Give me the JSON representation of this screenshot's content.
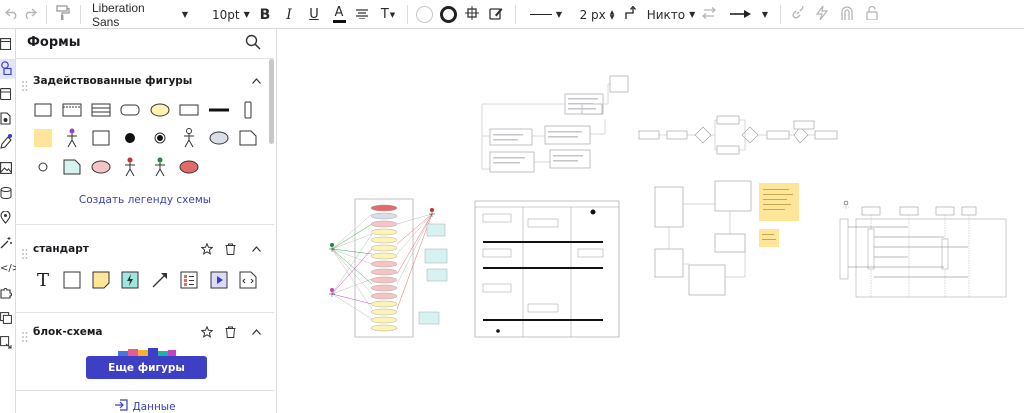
{
  "toolbar": {
    "font_family": "Liberation Sans",
    "font_size": "10pt",
    "bold": "B",
    "italic": "I",
    "underline": "U",
    "text_color_label": "A",
    "line_width": "2 px",
    "line_end": "Никто"
  },
  "panel": {
    "title": "Формы",
    "sections": [
      {
        "label": "Задействованные фигуры",
        "action": "Создать легенду схемы"
      },
      {
        "label": "стандарт"
      },
      {
        "label": "блок-схема"
      }
    ],
    "more_shapes": "Еще фигуры",
    "data_link": "Данные"
  },
  "colors": {
    "accent": "#3d3fc4",
    "note_yellow": "#fde69a",
    "teal_fill": "#d6f3f1",
    "pink_fill": "#f6c4c4",
    "red_fill": "#e36a6a",
    "grey_fill": "#d9dee6",
    "ellipse_yellow": "#fcf3b4"
  }
}
